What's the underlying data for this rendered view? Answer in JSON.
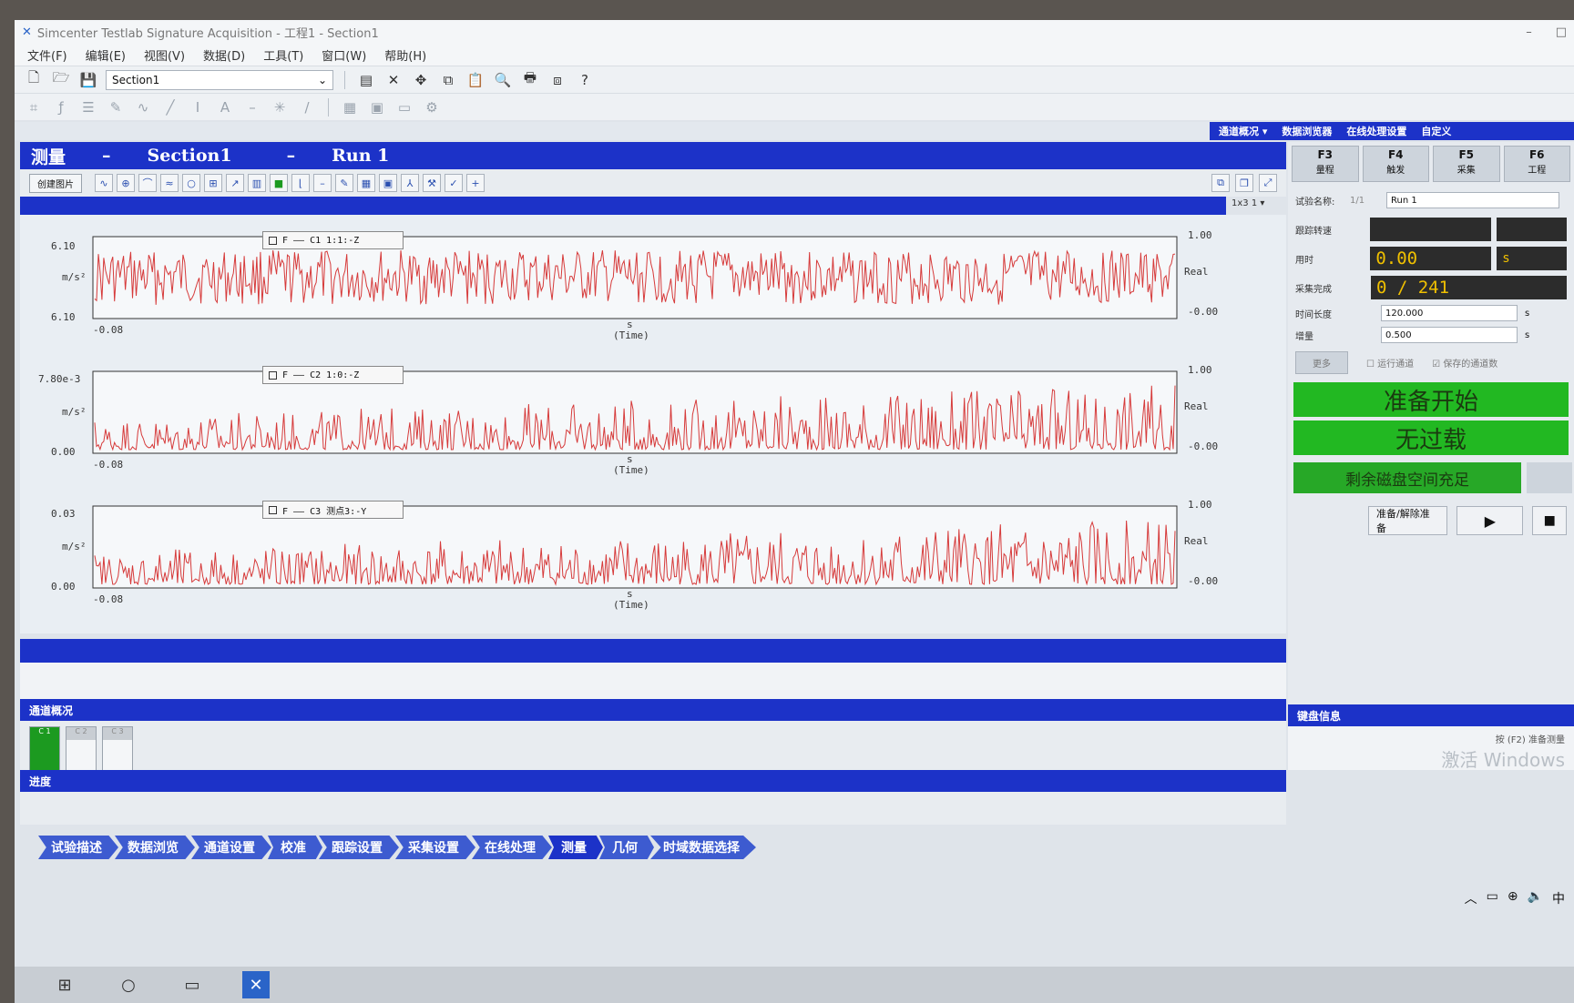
{
  "window": {
    "title": "Simcenter Testlab Signature Acquisition - 工程1 - Section1",
    "controls": [
      "–",
      "□"
    ]
  },
  "menu": [
    "文件(F)",
    "编辑(E)",
    "视图(V)",
    "数据(D)",
    "工具(T)",
    "窗口(W)",
    "帮助(H)"
  ],
  "toolbar": {
    "section_value": "Section1"
  },
  "top_links": [
    "通道概况 ▾",
    "数据浏览器",
    "在线处理设置",
    "自定义"
  ],
  "measure_header": {
    "title": "测量",
    "dash1": "–",
    "section": "Section1",
    "dash2": "–",
    "run": "Run 1"
  },
  "display": {
    "create_button": "创建图片",
    "layout_value": "1x3 1 ▾"
  },
  "plots": [
    {
      "legend": "F —— C1 1:1:-Z",
      "y_top": "6.10",
      "y_mid": "m/s²",
      "y_bot": "6.10",
      "x_left": "-0.08",
      "x_unit": "s",
      "x_label": "(Time)",
      "r_top": "1.00",
      "r_mid": "Real",
      "r_bot": "-0.00"
    },
    {
      "legend": "F —— C2 1:0:-Z",
      "y_top": "7.80e-3",
      "y_mid": "m/s²",
      "y_bot": "0.00",
      "x_left": "-0.08",
      "x_unit": "s",
      "x_label": "(Time)",
      "r_top": "1.00",
      "r_mid": "Real",
      "r_bot": "-0.00"
    },
    {
      "legend": "F —— C3 测点3:-Y",
      "y_top": "0.03",
      "y_mid": "m/s²",
      "y_bot": "0.00",
      "x_left": "-0.08",
      "x_unit": "s",
      "x_label": "(Time)",
      "r_top": "1.00",
      "r_mid": "Real",
      "r_bot": "-0.00"
    }
  ],
  "channel_overview": {
    "title": "通道概况",
    "tiles": [
      "C 1",
      "C 2",
      "C 3"
    ]
  },
  "progress_title": "进度",
  "right": {
    "fkeys": [
      {
        "key": "F3",
        "label": "量程"
      },
      {
        "key": "F4",
        "label": "触发"
      },
      {
        "key": "F5",
        "label": "采集"
      },
      {
        "key": "F6",
        "label": "工程"
      }
    ],
    "run_name_label": "试验名称:",
    "run_name_prefix": "1/1",
    "run_name_value": "Run 1",
    "tracking_label": "跟踪转速",
    "time_label": "用时",
    "time_value": "0.00",
    "time_unit": "s",
    "acq_label": "采集完成",
    "acq_value": "0 / 241",
    "duration_label": "时间长度",
    "duration_value": "120.000",
    "duration_unit": "s",
    "overlap_label": "增量",
    "overlap_value": "0.500",
    "overlap_unit": "s",
    "more_button": "更多",
    "check1": "运行通道",
    "check2": "保存的通道数",
    "status_ready": "准备开始",
    "status_overload": "无过载",
    "status_disk": "剩余磁盘空间充足",
    "arm_button": "准备/解除准备",
    "play_icon": "▶",
    "stop_icon": "■",
    "key_info_title": "键盘信息",
    "key_info_text": "按 (F2) 准备测量",
    "watermark": "激活 Windows"
  },
  "workflow": [
    "试验描述",
    "数据浏览",
    "通道设置",
    "校准",
    "跟踪设置",
    "采集设置",
    "在线处理",
    "测量",
    "几何",
    "时域数据选择"
  ],
  "active_step": "测量",
  "tray": {
    "ime": "中"
  }
}
